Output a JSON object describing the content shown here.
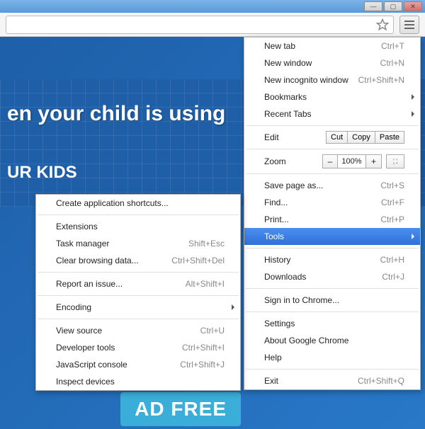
{
  "window_controls": {
    "min": "—",
    "max": "▢",
    "close": "✕"
  },
  "page": {
    "headline": "en your child is using",
    "subheadline": "UR KIDS",
    "download_btn": "AD FREE"
  },
  "main_menu": {
    "new_tab": {
      "label": "New tab",
      "shortcut": "Ctrl+T"
    },
    "new_window": {
      "label": "New window",
      "shortcut": "Ctrl+N"
    },
    "new_incognito": {
      "label": "New incognito window",
      "shortcut": "Ctrl+Shift+N"
    },
    "bookmarks": {
      "label": "Bookmarks"
    },
    "recent_tabs": {
      "label": "Recent Tabs"
    },
    "edit": {
      "label": "Edit",
      "cut": "Cut",
      "copy": "Copy",
      "paste": "Paste"
    },
    "zoom": {
      "label": "Zoom",
      "minus": "–",
      "value": "100%",
      "plus": "+",
      "fullscreen": "⛶"
    },
    "save_as": {
      "label": "Save page as...",
      "shortcut": "Ctrl+S"
    },
    "find": {
      "label": "Find...",
      "shortcut": "Ctrl+F"
    },
    "print": {
      "label": "Print...",
      "shortcut": "Ctrl+P"
    },
    "tools": {
      "label": "Tools"
    },
    "history": {
      "label": "History",
      "shortcut": "Ctrl+H"
    },
    "downloads": {
      "label": "Downloads",
      "shortcut": "Ctrl+J"
    },
    "signin": {
      "label": "Sign in to Chrome..."
    },
    "settings": {
      "label": "Settings"
    },
    "about": {
      "label": "About Google Chrome"
    },
    "help": {
      "label": "Help"
    },
    "exit": {
      "label": "Exit",
      "shortcut": "Ctrl+Shift+Q"
    }
  },
  "tools_menu": {
    "create_shortcuts": {
      "label": "Create application shortcuts..."
    },
    "extensions": {
      "label": "Extensions"
    },
    "task_manager": {
      "label": "Task manager",
      "shortcut": "Shift+Esc"
    },
    "clear_data": {
      "label": "Clear browsing data...",
      "shortcut": "Ctrl+Shift+Del"
    },
    "report_issue": {
      "label": "Report an issue...",
      "shortcut": "Alt+Shift+I"
    },
    "encoding": {
      "label": "Encoding"
    },
    "view_source": {
      "label": "View source",
      "shortcut": "Ctrl+U"
    },
    "dev_tools": {
      "label": "Developer tools",
      "shortcut": "Ctrl+Shift+I"
    },
    "js_console": {
      "label": "JavaScript console",
      "shortcut": "Ctrl+Shift+J"
    },
    "inspect_devices": {
      "label": "Inspect devices"
    }
  }
}
